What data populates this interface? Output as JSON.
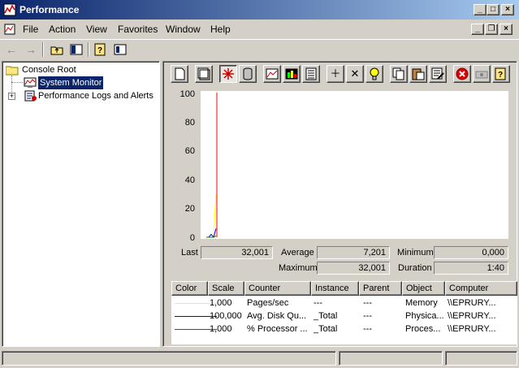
{
  "window": {
    "title": "Performance",
    "buttons": {
      "minimize": "_",
      "maximize": "□",
      "close": "×"
    }
  },
  "menu": {
    "items": [
      "File",
      "Action",
      "View",
      "Favorites",
      "Window",
      "Help"
    ]
  },
  "toolbar": {
    "back_icon": "back-arrow-icon",
    "forward_icon": "forward-arrow-icon"
  },
  "tree": {
    "root": "Console Root",
    "items": [
      "System Monitor",
      "Performance Logs and Alerts"
    ],
    "expander": "+"
  },
  "graph": {
    "y_ticks": [
      "100",
      "80",
      "60",
      "40",
      "20",
      "0"
    ],
    "series_colors": {
      "pages": "#ffff00",
      "disk": "#0000ff",
      "processor": "#008000",
      "line": "#ff0000"
    }
  },
  "chart_data": {
    "type": "line",
    "ylim": [
      0,
      100
    ],
    "series": [
      {
        "name": "Pages/sec",
        "color": "#ffff00",
        "values": [
          0,
          0,
          0,
          0,
          30
        ]
      },
      {
        "name": "Avg. Disk Qu...",
        "color": "#0000ff",
        "values": [
          0,
          0,
          2,
          0,
          6
        ]
      },
      {
        "name": "% Processor ...",
        "color": "#008000",
        "values": [
          0,
          0,
          0,
          0,
          1
        ]
      }
    ],
    "grid": false
  },
  "stats": {
    "last_label": "Last",
    "last_value": "32,001",
    "average_label": "Average",
    "average_value": "7,201",
    "minimum_label": "Minimum",
    "minimum_value": "0,000",
    "maximum_label": "Maximum",
    "maximum_value": "32,001",
    "duration_label": "Duration",
    "duration_value": "1:40"
  },
  "legend": {
    "columns": [
      "Color",
      "Scale",
      "Counter",
      "Instance",
      "Parent",
      "Object",
      "Computer"
    ],
    "rows": [
      {
        "color": "#ffff00",
        "scale": "1,000",
        "counter": "Pages/sec",
        "instance": "---",
        "parent": "---",
        "object": "Memory",
        "computer": "\\\\EPRURY..."
      },
      {
        "color": "#0000ff",
        "scale": "100,000",
        "counter": "Avg. Disk Qu...",
        "instance": "_Total",
        "parent": "---",
        "object": "Physica...",
        "computer": "\\\\EPRURY..."
      },
      {
        "color": "#008000",
        "scale": "1,000",
        "counter": "% Processor ...",
        "instance": "_Total",
        "parent": "---",
        "object": "Proces...",
        "computer": "\\\\EPRURY..."
      }
    ]
  }
}
